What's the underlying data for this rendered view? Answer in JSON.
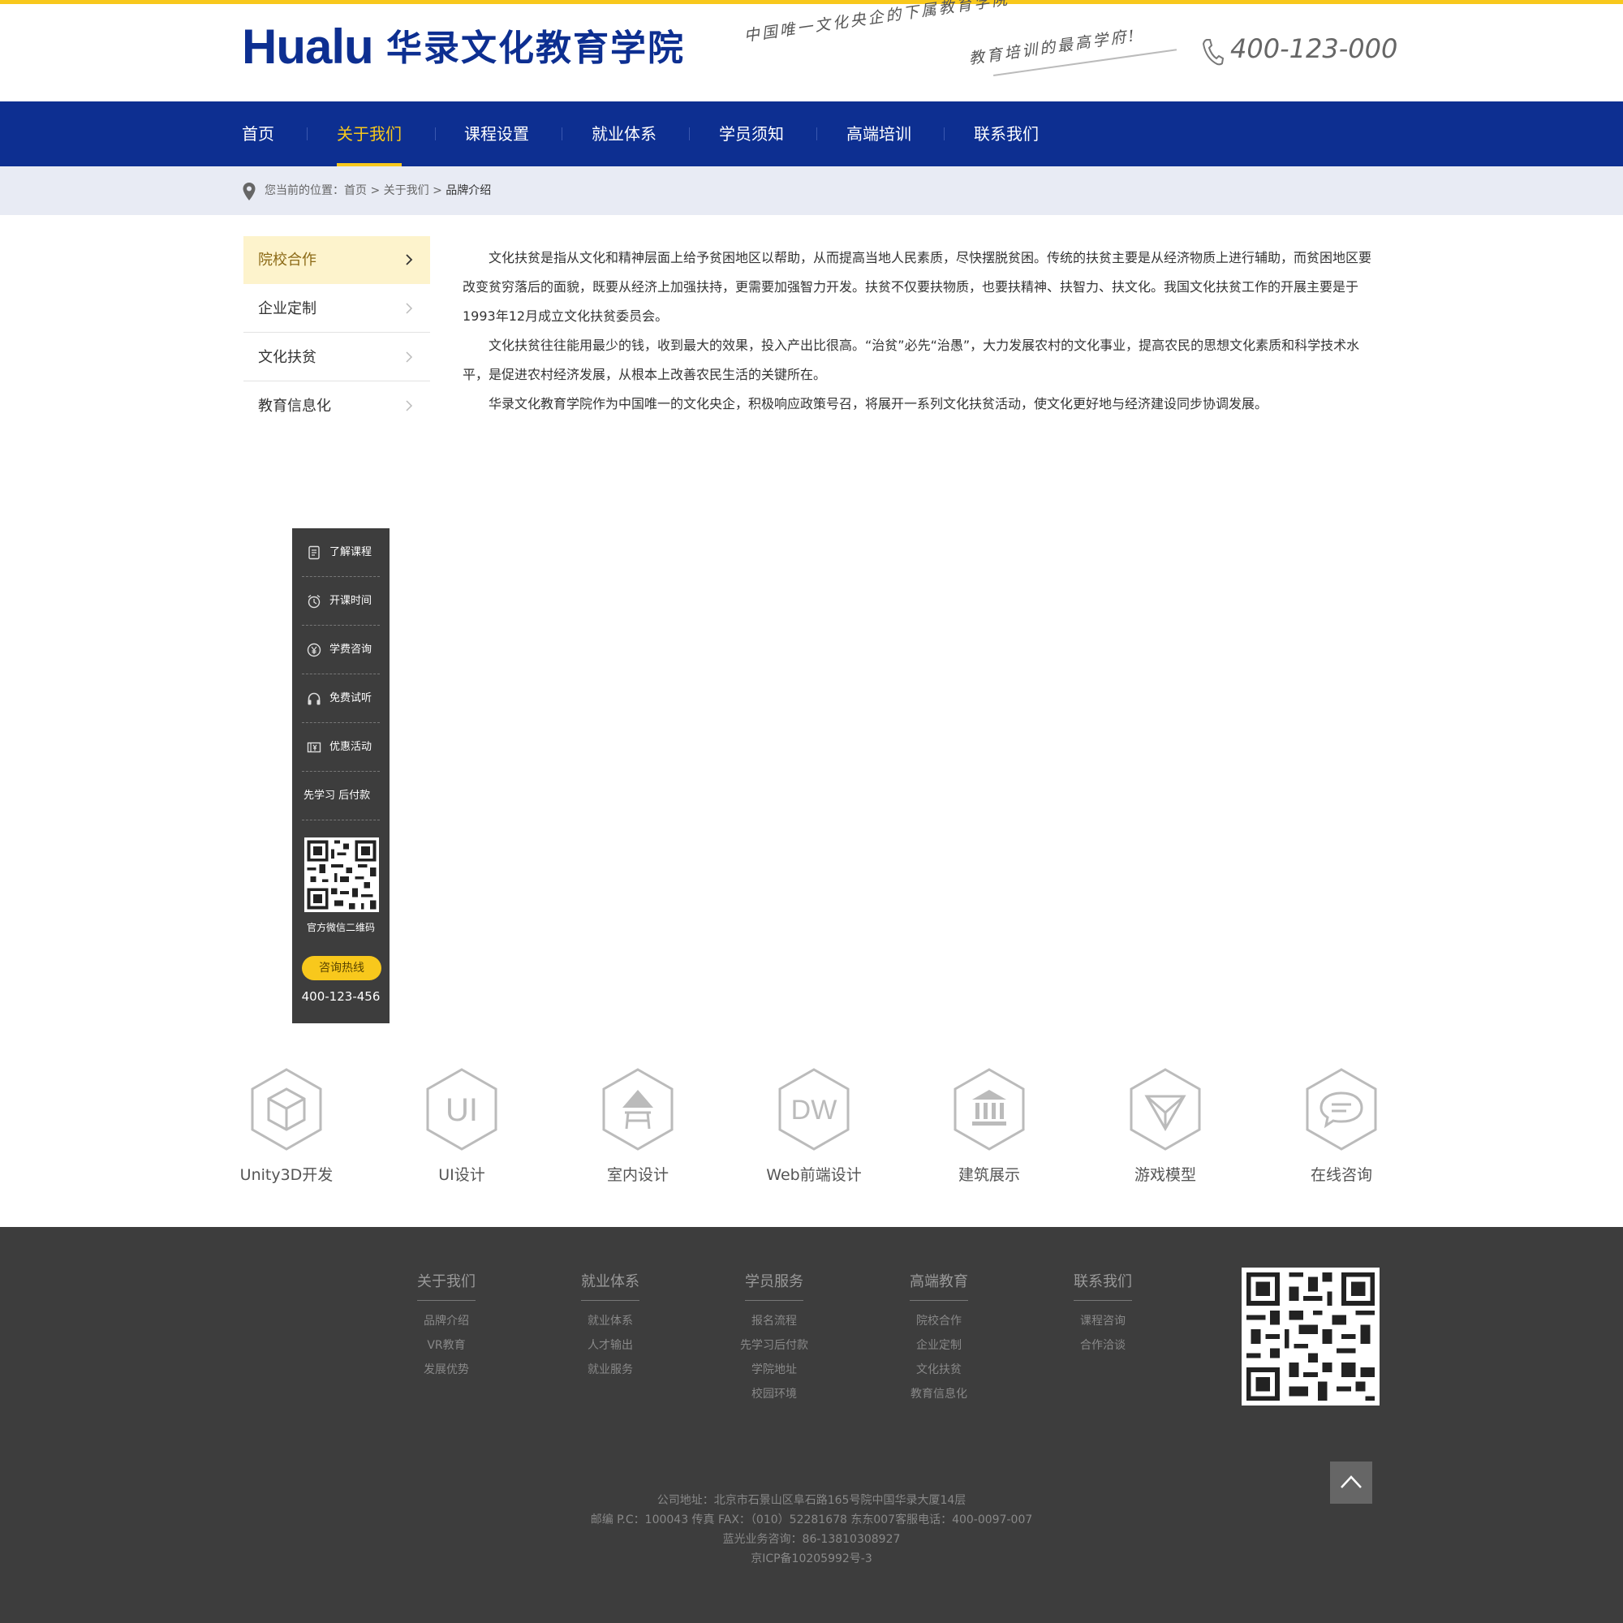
{
  "header": {
    "logo_en": "Hualu",
    "logo_cn": "华录文化教育学院",
    "slogan_line1": "中国唯一文化央企的下属教育学院",
    "slogan_line2": "教育培训的最高学府!",
    "phone": "400-123-000",
    "accent_color": "#f8c81c",
    "brand_color": "#0d2f91"
  },
  "nav": {
    "items": [
      {
        "label": "首页"
      },
      {
        "label": "关于我们"
      },
      {
        "label": "课程设置"
      },
      {
        "label": "就业体系"
      },
      {
        "label": "学员须知"
      },
      {
        "label": "高端培训"
      },
      {
        "label": "联系我们"
      }
    ],
    "active_index": 1
  },
  "breadcrumb": {
    "prefix": "您当前的位置：",
    "home": "首页",
    "sep": " > ",
    "parent": "关于我们",
    "current": "品牌介绍"
  },
  "sidebar": {
    "items": [
      {
        "label": "院校合作"
      },
      {
        "label": "企业定制"
      },
      {
        "label": "文化扶贫"
      },
      {
        "label": "教育信息化"
      }
    ],
    "active_index": 0
  },
  "article": {
    "paragraphs": [
      "文化扶贫是指从文化和精神层面上给予贫困地区以帮助，从而提高当地人民素质，尽快摆脱贫困。传统的扶贫主要是从经济物质上进行辅助，而贫困地区要改变贫穷落后的面貌，既要从经济上加强扶持，更需要加强智力开发。扶贫不仅要扶物质，也要扶精神、扶智力、扶文化。我国文化扶贫工作的开展主要是于1993年12月成立文化扶贫委员会。",
      "文化扶贫往往能用最少的钱，收到最大的效果，投入产出比很高。“治贫”必先“治愚”，大力发展农村的文化事业，提高农民的思想文化素质和科学技术水平，是促进农村经济发展，从根本上改善农民生活的关键所在。",
      "华录文化教育学院作为中国唯一的文化央企，积极响应政策号召，将展开一系列文化扶贫活动，使文化更好地与经济建设同步协调发展。"
    ]
  },
  "float_bar": {
    "items": [
      {
        "label": "了解课程",
        "icon": "document-icon"
      },
      {
        "label": "开课时间",
        "icon": "alarm-clock-icon"
      },
      {
        "label": "学费咨询",
        "icon": "yuan-coin-icon"
      },
      {
        "label": "免费试听",
        "icon": "headphones-icon"
      },
      {
        "label": "优惠活动",
        "icon": "coupon-icon"
      },
      {
        "label": "先学习 后付款",
        "icon": ""
      }
    ],
    "qr_label": "官方微信二维码",
    "hotline_label": "咨询热线",
    "hotline_number": "400-123-456"
  },
  "features": [
    {
      "label": "Unity3D开发",
      "icon": "cube-icon"
    },
    {
      "label": "UI设计",
      "icon": "ui-text-icon"
    },
    {
      "label": "室内设计",
      "icon": "lamp-table-icon"
    },
    {
      "label": "Web前端设计",
      "icon": "dw-text-icon"
    },
    {
      "label": "建筑展示",
      "icon": "building-columns-icon"
    },
    {
      "label": "游戏模型",
      "icon": "triangle-model-icon"
    },
    {
      "label": "在线咨询",
      "icon": "chat-bubble-icon"
    }
  ],
  "footer": {
    "columns": [
      {
        "title": "关于我们",
        "links": [
          "品牌介绍",
          "VR教育",
          "发展优势"
        ]
      },
      {
        "title": "就业体系",
        "links": [
          "就业体系",
          "人才输出",
          "就业服务"
        ]
      },
      {
        "title": "学员服务",
        "links": [
          "报名流程",
          "先学习后付款",
          "学院地址",
          "校园环境"
        ]
      },
      {
        "title": "高端教育",
        "links": [
          "院校合作",
          "企业定制",
          "文化扶贫",
          "教育信息化"
        ]
      },
      {
        "title": "联系我们",
        "links": [
          "课程咨询",
          "合作洽谈"
        ]
      }
    ],
    "address_lines": [
      "公司地址：北京市石景山区阜石路165号院中国华录大厦14层",
      "邮编 P.C：100043 传真 FAX：（010）52281678 东东007客服电话：400-0097-007",
      "蓝光业务咨询：86-13810308927",
      "京ICP备10205992号-3"
    ]
  }
}
